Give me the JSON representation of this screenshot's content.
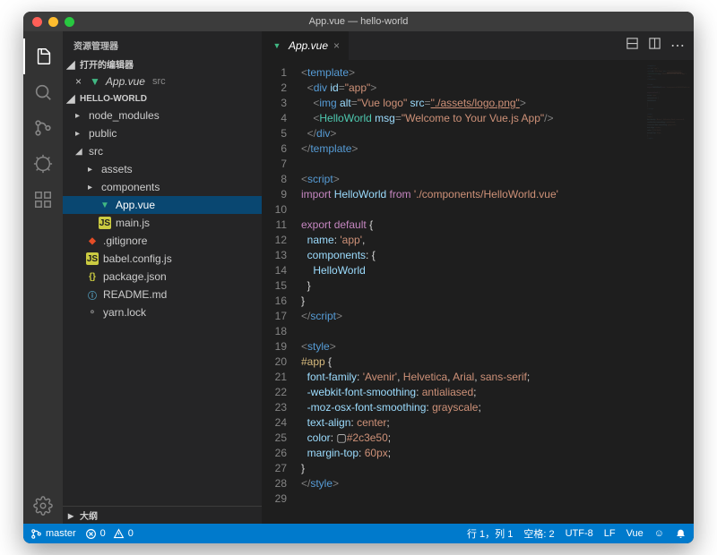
{
  "title": "App.vue — hello-world",
  "sidebar_title": "资源管理器",
  "open_editors_label": "打开的编辑器",
  "project_label": "HELLO-WORLD",
  "outline_label": "大纲",
  "open_editor": {
    "name": "App.vue",
    "dir": "src"
  },
  "tree": {
    "node_modules": "node_modules",
    "public": "public",
    "src": "src",
    "assets": "assets",
    "components": "components",
    "app_vue": "App.vue",
    "main_js": "main.js",
    "gitignore": ".gitignore",
    "babel": "babel.config.js",
    "pkg": "package.json",
    "readme": "README.md",
    "yarn": "yarn.lock"
  },
  "tab": {
    "name": "App.vue"
  },
  "code": [
    {
      "n": 1,
      "h": "<span class='c-tag'>&lt;</span><span class='c-name'>template</span><span class='c-tag'>&gt;</span>"
    },
    {
      "n": 2,
      "h": "  <span class='c-tag'>&lt;</span><span class='c-name'>div</span> <span class='c-attr'>id</span><span class='c-tag'>=</span><span class='c-str'>\"app\"</span><span class='c-tag'>&gt;</span>"
    },
    {
      "n": 3,
      "h": "    <span class='c-tag'>&lt;</span><span class='c-name'>img</span> <span class='c-attr'>alt</span><span class='c-tag'>=</span><span class='c-str'>\"Vue logo\"</span> <span class='c-attr'>src</span><span class='c-tag'>=</span><span class='c-str2'>\"./assets/logo.png\"</span><span class='c-tag'>&gt;</span>"
    },
    {
      "n": 4,
      "h": "    <span class='c-tag'>&lt;</span><span class='c-fn'>HelloWorld</span> <span class='c-attr'>msg</span><span class='c-tag'>=</span><span class='c-str'>\"Welcome to Your Vue.js App\"</span><span class='c-tag'>/&gt;</span>"
    },
    {
      "n": 5,
      "h": "  <span class='c-tag'>&lt;/</span><span class='c-name'>div</span><span class='c-tag'>&gt;</span>"
    },
    {
      "n": 6,
      "h": "<span class='c-tag'>&lt;/</span><span class='c-name'>template</span><span class='c-tag'>&gt;</span>"
    },
    {
      "n": 7,
      "h": ""
    },
    {
      "n": 8,
      "h": "<span class='c-tag'>&lt;</span><span class='c-name'>script</span><span class='c-tag'>&gt;</span>"
    },
    {
      "n": 9,
      "h": "<span class='c-kw'>import</span> <span class='c-id'>HelloWorld</span> <span class='c-kw'>from</span> <span class='c-str'>'./components/HelloWorld.vue'</span>"
    },
    {
      "n": 10,
      "h": ""
    },
    {
      "n": 11,
      "h": "<span class='c-kw'>export</span> <span class='c-kw'>default</span> <span class='c-punc'>{</span>"
    },
    {
      "n": 12,
      "h": "  <span class='c-prop'>name</span><span class='c-punc'>:</span> <span class='c-str'>'app'</span><span class='c-punc'>,</span>"
    },
    {
      "n": 13,
      "h": "  <span class='c-prop'>components</span><span class='c-punc'>:</span> <span class='c-punc'>{</span>"
    },
    {
      "n": 14,
      "h": "    <span class='c-id'>HelloWorld</span>"
    },
    {
      "n": 15,
      "h": "  <span class='c-punc'>}</span>"
    },
    {
      "n": 16,
      "h": "<span class='c-punc'>}</span>"
    },
    {
      "n": 17,
      "h": "<span class='c-tag'>&lt;/</span><span class='c-name'>script</span><span class='c-tag'>&gt;</span>"
    },
    {
      "n": 18,
      "h": ""
    },
    {
      "n": 19,
      "h": "<span class='c-tag'>&lt;</span><span class='c-name'>style</span><span class='c-tag'>&gt;</span>"
    },
    {
      "n": 20,
      "h": "<span class='c-sel'>#app</span> <span class='c-punc'>{</span>"
    },
    {
      "n": 21,
      "h": "  <span class='c-cssprop'>font-family</span><span class='c-punc'>:</span> <span class='c-cssval'>'Avenir'</span><span class='c-punc'>,</span> <span class='c-cssval'>Helvetica</span><span class='c-punc'>,</span> <span class='c-cssval'>Arial</span><span class='c-punc'>,</span> <span class='c-cssval'>sans-serif</span><span class='c-punc'>;</span>"
    },
    {
      "n": 22,
      "h": "  <span class='c-cssprop'>-webkit-font-smoothing</span><span class='c-punc'>:</span> <span class='c-cssval'>antialiased</span><span class='c-punc'>;</span>"
    },
    {
      "n": 23,
      "h": "  <span class='c-cssprop'>-moz-osx-font-smoothing</span><span class='c-punc'>:</span> <span class='c-cssval'>grayscale</span><span class='c-punc'>;</span>"
    },
    {
      "n": 24,
      "h": "  <span class='c-cssprop'>text-align</span><span class='c-punc'>:</span> <span class='c-cssval'>center</span><span class='c-punc'>;</span>"
    },
    {
      "n": 25,
      "h": "  <span class='c-cssprop'>color</span><span class='c-punc'>:</span> <span class='c-white'>▢</span><span class='c-cssval'>#2c3e50</span><span class='c-punc'>;</span>"
    },
    {
      "n": 26,
      "h": "  <span class='c-cssprop'>margin-top</span><span class='c-punc'>:</span> <span class='c-cssval'>60px</span><span class='c-punc'>;</span>"
    },
    {
      "n": 27,
      "h": "<span class='c-punc'>}</span>"
    },
    {
      "n": 28,
      "h": "<span class='c-tag'>&lt;/</span><span class='c-name'>style</span><span class='c-tag'>&gt;</span>"
    },
    {
      "n": 29,
      "h": ""
    }
  ],
  "status": {
    "branch": "master",
    "errors": "0",
    "warnings": "0",
    "cursor": "行 1，列 1",
    "spaces": "空格: 2",
    "encoding": "UTF-8",
    "eol": "LF",
    "lang": "Vue",
    "smile": "☺"
  }
}
